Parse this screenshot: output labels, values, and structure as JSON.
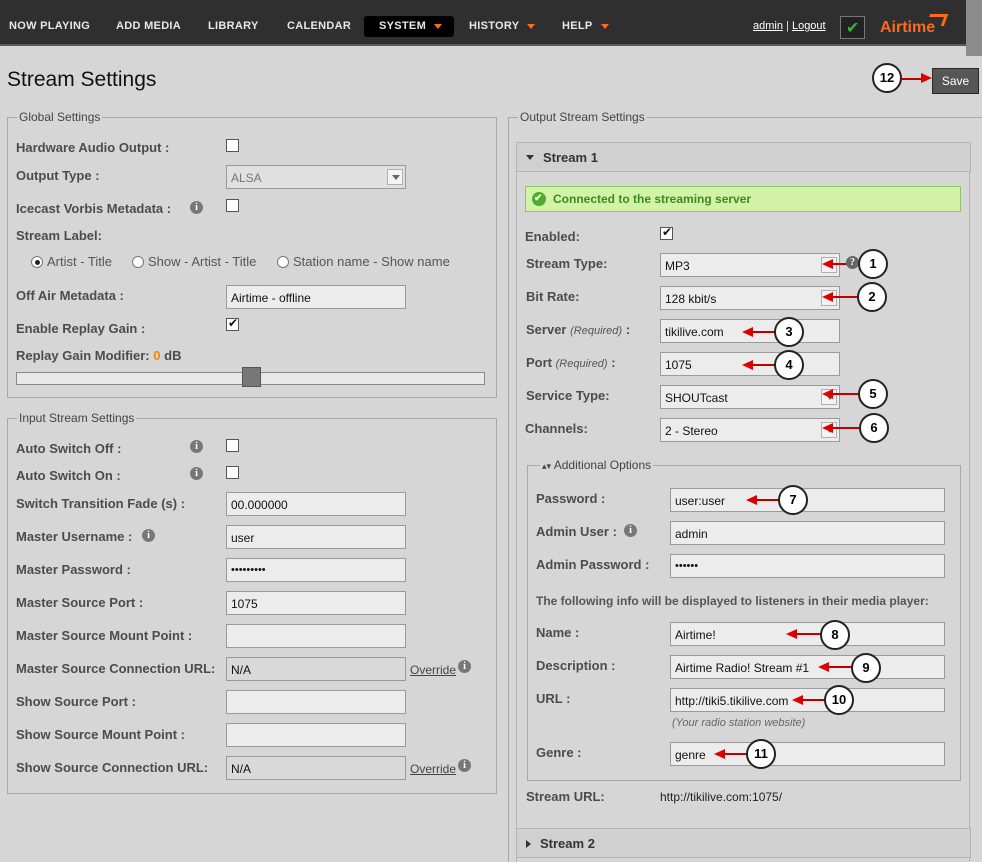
{
  "nav": {
    "items": [
      {
        "label": "NOW PLAYING",
        "caret": false
      },
      {
        "label": "ADD MEDIA",
        "caret": false
      },
      {
        "label": "LIBRARY",
        "caret": false
      },
      {
        "label": "CALENDAR",
        "caret": false
      },
      {
        "label": "SYSTEM",
        "caret": true,
        "active": true
      },
      {
        "label": "HISTORY",
        "caret": true
      },
      {
        "label": "HELP",
        "caret": true
      }
    ],
    "user": "admin",
    "separator": "|",
    "logout": "Logout",
    "logo": "Airtime",
    "accent_color": "#ff6a1a"
  },
  "page": {
    "title": "Stream Settings",
    "save_label": "Save"
  },
  "global": {
    "legend": "Global Settings",
    "hardware_audio_output": {
      "label": "Hardware Audio Output :",
      "checked": false
    },
    "output_type": {
      "label": "Output Type :",
      "value": "ALSA"
    },
    "icecast_vorbis": {
      "label": "Icecast Vorbis Metadata :",
      "checked": false
    },
    "stream_label": {
      "label": "Stream Label:",
      "options": [
        "Artist - Title",
        "Show - Artist - Title",
        "Station name - Show name"
      ],
      "selected": 0
    },
    "off_air_metadata": {
      "label": "Off Air Metadata :",
      "value": "Airtime - offline"
    },
    "enable_replay_gain": {
      "label": "Enable Replay Gain :",
      "checked": true
    },
    "replay_gain_modifier": {
      "label": "Replay Gain Modifier:",
      "value": "0",
      "unit": "dB"
    }
  },
  "input": {
    "legend": "Input Stream Settings",
    "auto_switch_off": {
      "label": "Auto Switch Off :",
      "checked": false
    },
    "auto_switch_on": {
      "label": "Auto Switch On :",
      "checked": false
    },
    "switch_transition_fade": {
      "label": "Switch Transition Fade (s) :",
      "value": "00.000000"
    },
    "master_username": {
      "label": "Master Username :",
      "value": "user"
    },
    "master_password": {
      "label": "Master Password :",
      "value": "•••••••••"
    },
    "master_source_port": {
      "label": "Master Source Port :",
      "value": "1075"
    },
    "master_source_mount": {
      "label": "Master Source Mount Point :",
      "value": ""
    },
    "master_source_url": {
      "label": "Master Source Connection URL:",
      "value": "N/A",
      "override": "Override"
    },
    "show_source_port": {
      "label": "Show Source Port :",
      "value": ""
    },
    "show_source_mount": {
      "label": "Show Source Mount Point :",
      "value": ""
    },
    "show_source_url": {
      "label": "Show Source Connection URL:",
      "value": "N/A",
      "override": "Override"
    }
  },
  "output": {
    "legend": "Output Stream Settings",
    "stream1": {
      "title": "Stream 1",
      "status": "Connected to the streaming server",
      "enabled": {
        "label": "Enabled:",
        "checked": true
      },
      "stream_type": {
        "label": "Stream Type:",
        "value": "MP3"
      },
      "bit_rate": {
        "label": "Bit Rate:",
        "value": "128 kbit/s"
      },
      "server": {
        "label": "Server",
        "req": "(Required)",
        "colon": ":",
        "value": "tikilive.com"
      },
      "port": {
        "label": "Port",
        "req": "(Required)",
        "colon": ":",
        "value": "1075"
      },
      "service_type": {
        "label": "Service Type:",
        "value": "SHOUTcast"
      },
      "channels": {
        "label": "Channels:",
        "value": "2 - Stereo"
      },
      "additional": {
        "legend": "Additional Options",
        "password": {
          "label": "Password :",
          "value": "user:user"
        },
        "admin_user": {
          "label": "Admin User :",
          "value": "admin"
        },
        "admin_password": {
          "label": "Admin Password :",
          "value": "••••••"
        },
        "note": "The following info will be displayed to listeners in their media player:",
        "name": {
          "label": "Name :",
          "value": "Airtime!"
        },
        "description": {
          "label": "Description :",
          "value": "Airtime Radio! Stream #1"
        },
        "url": {
          "label": "URL :",
          "value": "http://tiki5.tikilive.com",
          "hint": "(Your radio station website)"
        },
        "genre": {
          "label": "Genre :",
          "value": "genre"
        }
      },
      "stream_url": {
        "label": "Stream URL:",
        "value": "http://tikilive.com:1075/"
      }
    },
    "stream2": {
      "title": "Stream 2"
    }
  },
  "callouts": [
    "1",
    "2",
    "3",
    "4",
    "5",
    "6",
    "7",
    "8",
    "9",
    "10",
    "11",
    "12"
  ]
}
